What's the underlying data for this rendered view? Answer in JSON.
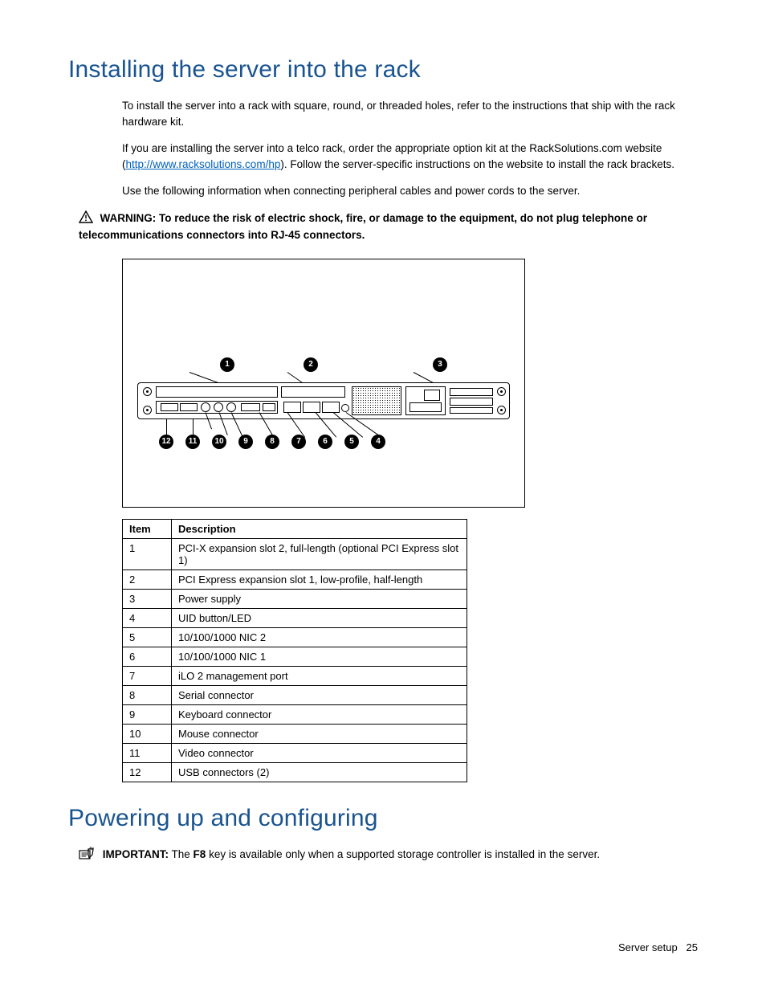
{
  "heading1": "Installing the server into the rack",
  "para1": "To install the server into a rack with square, round, or threaded holes, refer to the instructions that ship with the rack hardware kit.",
  "para2_pre": "If you are installing the server into a telco rack, order the appropriate option kit at the RackSolutions.com website (",
  "para2_link": "http://www.racksolutions.com/hp",
  "para2_post": "). Follow the server-specific instructions on the website to install the rack brackets.",
  "para3": "Use the following information when connecting peripheral cables and power cords to the server.",
  "warning_label": "WARNING:",
  "warning_text": "  To reduce the risk of electric shock, fire, or damage to the equipment, do not plug telephone or telecommunications connectors into RJ-45 connectors.",
  "table": {
    "head_item": "Item",
    "head_desc": "Description",
    "rows": [
      {
        "item": "1",
        "desc": "PCI-X expansion slot 2, full-length (optional PCI Express slot 1)"
      },
      {
        "item": "2",
        "desc": "PCI Express expansion slot 1, low-profile, half-length"
      },
      {
        "item": "3",
        "desc": "Power supply"
      },
      {
        "item": "4",
        "desc": "UID button/LED"
      },
      {
        "item": "5",
        "desc": "10/100/1000 NIC 2"
      },
      {
        "item": "6",
        "desc": "10/100/1000 NIC 1"
      },
      {
        "item": "7",
        "desc": "iLO 2 management port"
      },
      {
        "item": "8",
        "desc": "Serial connector"
      },
      {
        "item": "9",
        "desc": "Keyboard connector"
      },
      {
        "item": "10",
        "desc": "Mouse connector"
      },
      {
        "item": "11",
        "desc": "Video connector"
      },
      {
        "item": "12",
        "desc": "USB connectors (2)"
      }
    ]
  },
  "callouts": {
    "c1": "1",
    "c2": "2",
    "c3": "3",
    "c4": "4",
    "c5": "5",
    "c6": "6",
    "c7": "7",
    "c8": "8",
    "c9": "9",
    "c10": "10",
    "c11": "11",
    "c12": "12"
  },
  "heading2": "Powering up and configuring",
  "important_label": "IMPORTANT:",
  "important_pre": "  The ",
  "important_key": "F8",
  "important_post": " key is available only when a supported storage controller is installed in the server.",
  "footer_section": "Server setup",
  "footer_page": "25"
}
